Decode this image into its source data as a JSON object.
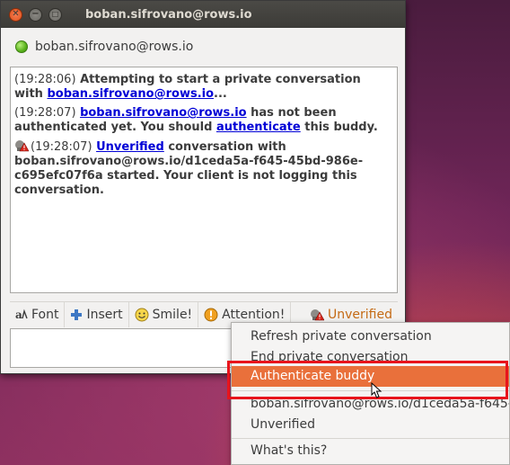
{
  "window": {
    "title": "boban.sifrovano@rows.io"
  },
  "header": {
    "buddy_name": "boban.sifrovano@rows.io",
    "status_color": "#59b21c"
  },
  "conversation": {
    "messages": [
      {
        "time": "(19:28:06)",
        "text": "Attempting to start a private conversation with",
        "link": "boban.sifrovano@rows.io",
        "suffix": "..."
      },
      {
        "time": "(19:28:07)",
        "link": "boban.sifrovano@rows.io",
        "text": "has not been authenticated yet.  You should",
        "link2": "authenticate",
        "suffix": "this buddy."
      },
      {
        "icon": "unverified-warning-icon",
        "time": "(19:28:07)",
        "link": "Unverified",
        "text": "conversation with boban.sifrovano@rows.io/d1ceda5a-f645-45bd-986e-c695efc07f6a started.  Your client is not logging this conversation."
      }
    ]
  },
  "toolbar": {
    "font_label": "Font",
    "insert_label": "Insert",
    "smile_label": "Smile!",
    "attention_label": "Attention!",
    "otr_label": "Unverified",
    "otr_color": "#c46a14"
  },
  "menu": {
    "items": [
      {
        "label": "Refresh private conversation"
      },
      {
        "label": "End private conversation"
      },
      {
        "label": "Authenticate buddy",
        "selected": true
      },
      {
        "label": "boban.sifrovano@rows.io/d1ceda5a-f645-"
      },
      {
        "label": "Unverified"
      },
      {
        "label": "What's this?"
      }
    ],
    "accent_color": "#e9703b",
    "highlight_color": "#e8141c"
  }
}
